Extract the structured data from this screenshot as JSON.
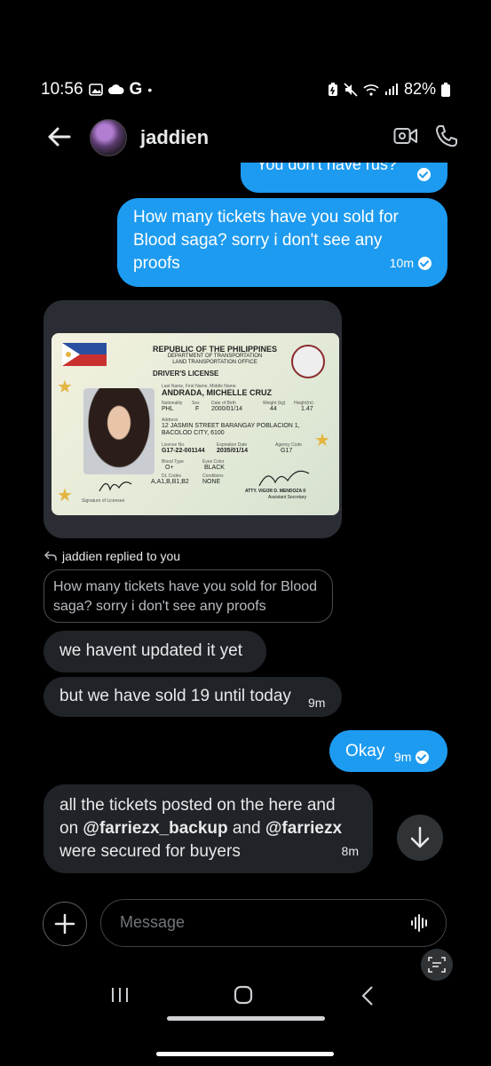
{
  "status": {
    "time": "10:56",
    "left_icons": [
      "gallery-icon",
      "cloud-icon"
    ],
    "google_letter": "G",
    "dot": "•",
    "battery": "82%"
  },
  "header": {
    "name": "jaddien"
  },
  "messages": {
    "cut_text": "You don't have rus?",
    "outgoing_1": {
      "text": "How many tickets have you sold for Blood saga? sorry i don't see any proofs",
      "time": "10m"
    },
    "id_card": {
      "republic": "REPUBLIC OF THE PHILIPPINES",
      "dept": "DEPARTMENT OF TRANSPORTATION",
      "office": "LAND TRANSPORTATION OFFICE",
      "license_title": "DRIVER'S LICENSE",
      "name_label": "Last Name, First Name, Middle Name",
      "name": "ANDRADA, MICHELLE CRUZ",
      "nat_label": "Nationality",
      "sex_label": "Sex",
      "dob_label": "Date of Birth",
      "weight_label": "Weight (kg)",
      "height_label": "Height(m)",
      "nationality": "PHL",
      "sex": "F",
      "dob": "2000/01/14",
      "weight": "44",
      "height": "1.47",
      "address_label": "Address",
      "address_1": "12 JASMIN STREET BARANGAY POBLACION 1,",
      "address_2": "BACOLOD CITY, 6100",
      "license_no_label": "License No.",
      "exp_label": "Expiration Date",
      "agency_label": "Agency Code",
      "license_no": "G17-22-001144",
      "expiration": "2035/01/14",
      "agency": "G17",
      "blood_label": "Blood Type",
      "eyes_label": "Eyes Color",
      "blood": "O+",
      "eyes": "BLACK",
      "dl_codes_label": "DL Codes",
      "conditions_label": "Conditions",
      "dl_codes": "A,A1,B,B1,B2",
      "conditions": "NONE",
      "signature_label": "Signature of Licensee",
      "officer": "ATTY. VIGOR D. MENDOZA II",
      "officer_title": "Assistant Secretary"
    },
    "replied_label": "jaddien replied to you",
    "quoted": "How many tickets have you sold for Blood saga? sorry i don't see any proofs",
    "incoming_1": {
      "text": "we havent updated it yet"
    },
    "incoming_2": {
      "text": "but we have sold 19 until today",
      "time": "9m"
    },
    "outgoing_2": {
      "text": "Okay",
      "time": "9m"
    },
    "incoming_3": {
      "line1": "all the tickets posted on the here and",
      "line2_a": "on ",
      "handle_1": "@farriezx_backup",
      "line2_b": " and ",
      "handle_2": "@farriezx",
      "line3": "were secured for buyers",
      "time": "8m"
    }
  },
  "composer": {
    "placeholder": "Message"
  },
  "colors": {
    "accent": "#1d9bf0",
    "incoming": "#202327",
    "background": "#000000"
  }
}
